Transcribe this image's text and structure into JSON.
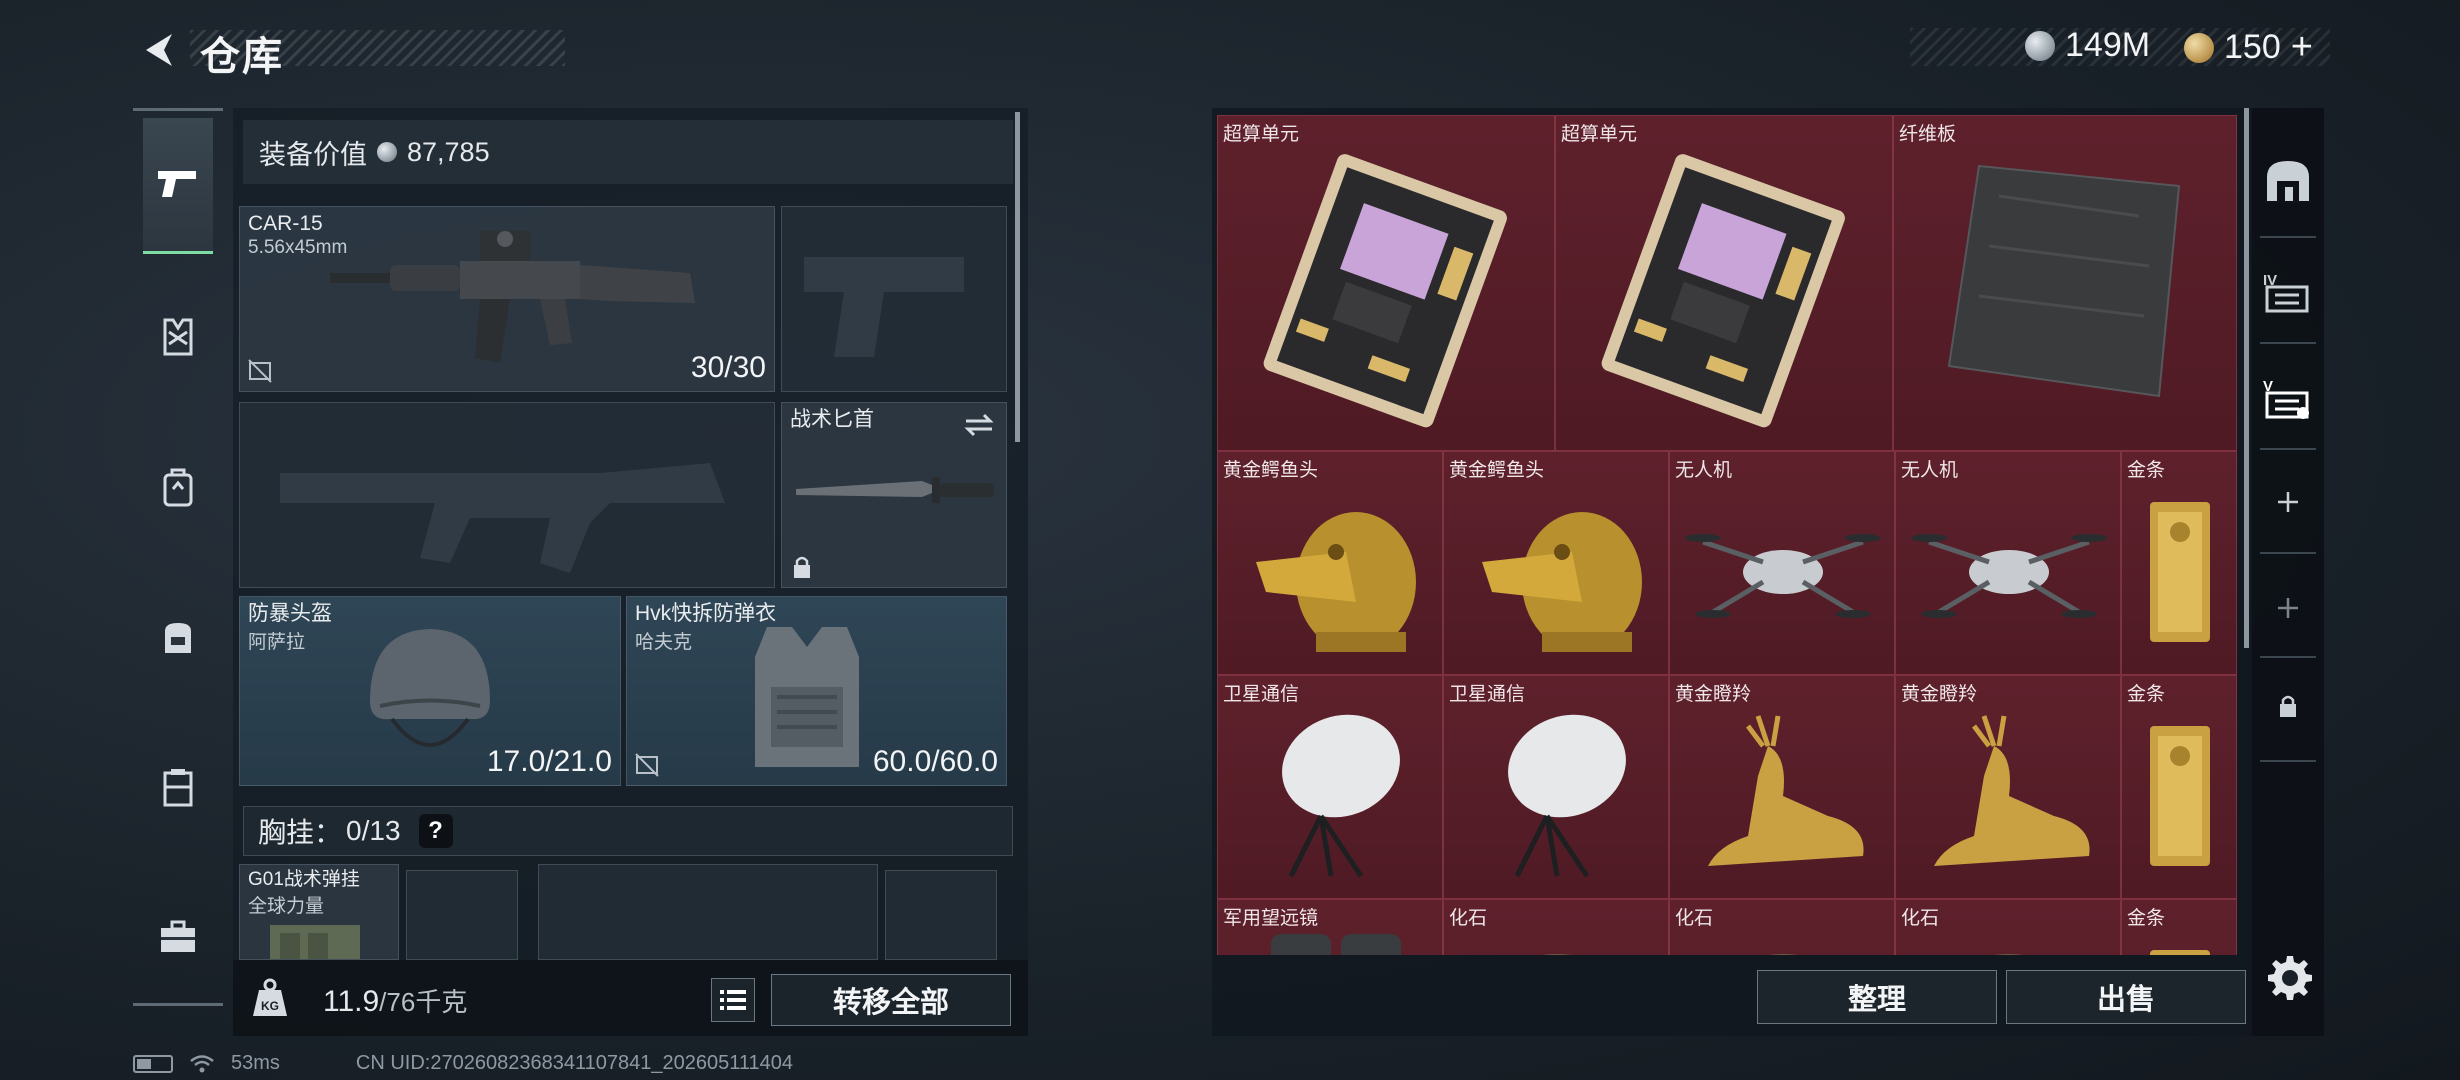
{
  "header": {
    "title": "仓库",
    "currencies": [
      {
        "icon": "silver-coin-icon",
        "value": "149M"
      },
      {
        "icon": "gold-coin-icon",
        "value": "150"
      },
      {
        "icon": "add-icon",
        "value": "+"
      }
    ]
  },
  "left_nav": {
    "items": [
      {
        "name": "weapon-icon",
        "active": true
      },
      {
        "name": "vest-icon",
        "active": false
      },
      {
        "name": "backpack-icon",
        "active": false
      },
      {
        "name": "pouch-icon",
        "active": false
      },
      {
        "name": "case-icon",
        "active": false
      },
      {
        "name": "toolbox-icon",
        "active": false
      }
    ]
  },
  "equipment": {
    "value_label": "装备价值",
    "value": "87,785",
    "primary": {
      "name": "CAR-15",
      "caliber": "5.56x45mm",
      "ammo": "30/30"
    },
    "knife": {
      "name": "战术匕首"
    },
    "helmet": {
      "name": "防暴头盔",
      "sub": "阿萨拉",
      "durability": "17.0/21.0"
    },
    "armor": {
      "name": "Hvk快拆防弹衣",
      "sub": "哈夫克",
      "durability": "60.0/60.0"
    },
    "vest": {
      "label": "胸挂：",
      "capacity": "0/13",
      "help": "?"
    },
    "vest_item": {
      "name": "G01战术弹挂",
      "sub": "全球力量"
    },
    "weight": "11.9",
    "weight_max": "/76千克",
    "transfer_all": "转移全部"
  },
  "stash": {
    "items": [
      {
        "name": "超算单元",
        "type": "chip"
      },
      {
        "name": "超算单元",
        "type": "chip"
      },
      {
        "name": "纤维板",
        "type": "board"
      },
      {
        "name": "黄金鳄鱼头",
        "type": "croc"
      },
      {
        "name": "黄金鳄鱼头",
        "type": "croc"
      },
      {
        "name": "无人机",
        "type": "drone"
      },
      {
        "name": "无人机",
        "type": "drone"
      },
      {
        "name": "金条",
        "type": "bar"
      },
      {
        "name": "卫星通信",
        "type": "dish"
      },
      {
        "name": "卫星通信",
        "type": "dish"
      },
      {
        "name": "黄金瞪羚",
        "type": "deer"
      },
      {
        "name": "黄金瞪羚",
        "type": "deer"
      },
      {
        "name": "金条",
        "type": "bar"
      },
      {
        "name": "军用望远镜",
        "type": "scope"
      },
      {
        "name": "化石",
        "type": "fossil"
      },
      {
        "name": "化石",
        "type": "fossil"
      },
      {
        "name": "化石",
        "type": "fossil"
      },
      {
        "name": "金条",
        "type": "bar"
      }
    ],
    "organize": "整理",
    "sell": "出售"
  },
  "colors": {
    "accent": "#7fdca5",
    "stash_bg": "#5a1d27",
    "armor_slot": "#2f4656"
  },
  "status": {
    "ping": "53ms",
    "uid": "CN UID:27026082368341107841_202605111404"
  }
}
